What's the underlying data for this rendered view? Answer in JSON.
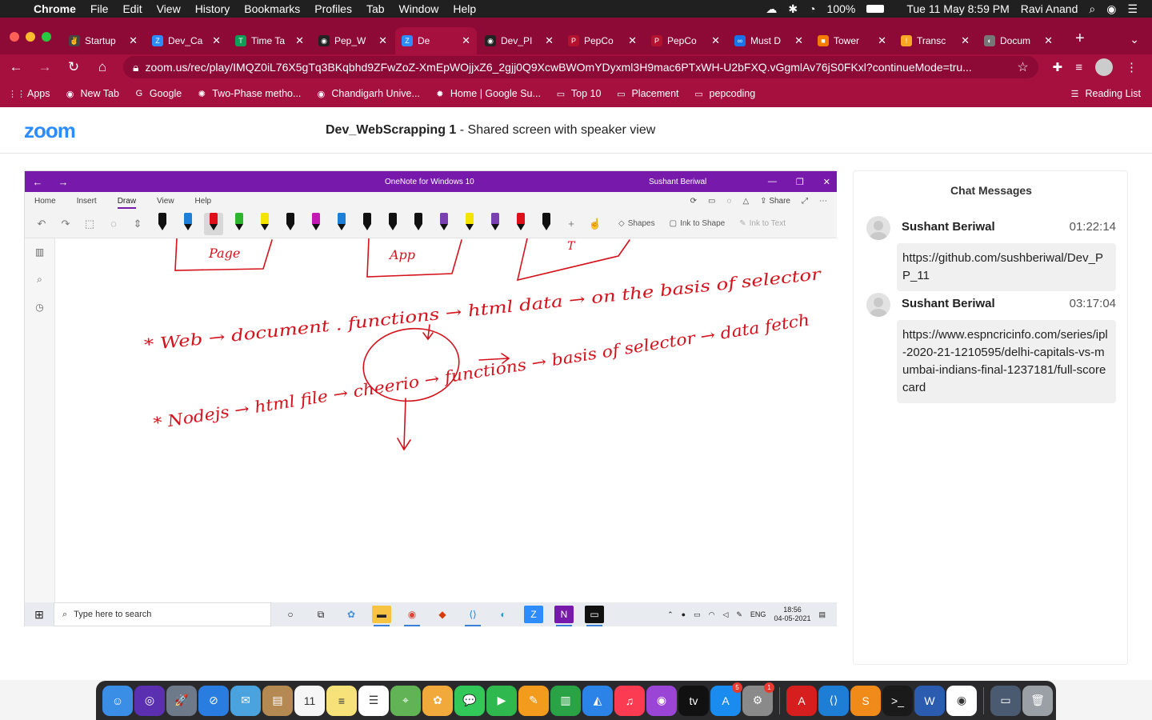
{
  "menubar": {
    "app": "Chrome",
    "items": [
      "File",
      "Edit",
      "View",
      "History",
      "Bookmarks",
      "Profiles",
      "Tab",
      "Window",
      "Help"
    ],
    "battery": "100%",
    "datetime": "Tue 11 May  8:59 PM",
    "user": "Ravi Anand"
  },
  "tabs": [
    {
      "title": "Startup",
      "color": "#444444",
      "glyph": "✌"
    },
    {
      "title": "Dev_Ca",
      "color": "#2d8cff",
      "glyph": "Z"
    },
    {
      "title": "Time Ta",
      "color": "#0f9d58",
      "glyph": "T"
    },
    {
      "title": "Pep_W",
      "color": "#222222",
      "glyph": "◉"
    },
    {
      "title": "De",
      "color": "#2d8cff",
      "glyph": "Z",
      "active": true
    },
    {
      "title": "Dev_PI",
      "color": "#222222",
      "glyph": "◉"
    },
    {
      "title": "PepCo",
      "color": "#b3122e",
      "glyph": "P"
    },
    {
      "title": "PepCo",
      "color": "#b3122e",
      "glyph": "P"
    },
    {
      "title": "Must D",
      "color": "#1a73e8",
      "glyph": "∞"
    },
    {
      "title": "Tower",
      "color": "#f57c00",
      "glyph": "■"
    },
    {
      "title": "Transc",
      "color": "#f9a825",
      "glyph": "!"
    },
    {
      "title": "Docum",
      "color": "#777777",
      "glyph": "◐"
    }
  ],
  "address": {
    "url": "zoom.us/rec/play/IMQZ0iL76X5gTq3BKqbhd9ZFwZoZ-XmEpWOjjxZ6_2gjj0Q9XcwBWOmYDyxml3H9mac6PTxWH-U2bFXQ.vGgmlAv76jS0FKxl?continueMode=tru..."
  },
  "bookmarks": [
    {
      "label": "Apps",
      "glyph": "⋮⋮"
    },
    {
      "label": "New Tab",
      "glyph": "◉"
    },
    {
      "label": "Google",
      "glyph": "G"
    },
    {
      "label": "Two-Phase metho...",
      "glyph": "✺"
    },
    {
      "label": "Chandigarh Unive...",
      "glyph": "◉"
    },
    {
      "label": "Home | Google Su...",
      "glyph": "✹"
    },
    {
      "label": "Top 10",
      "glyph": "▭"
    },
    {
      "label": "Placement",
      "glyph": "▭"
    },
    {
      "label": "pepcoding",
      "glyph": "▭"
    }
  ],
  "reading_list": "Reading List",
  "zoom": {
    "logo": "zoom",
    "title_bold": "Dev_WebScrapping 1",
    "title_rest": " - Shared screen with speaker view"
  },
  "onenote": {
    "title": "OneNote for Windows 10",
    "user": "Sushant Beriwal",
    "tabs": [
      "Home",
      "Insert",
      "Draw",
      "View",
      "Help"
    ],
    "share": "Share",
    "shapes": "Shapes",
    "ink_to_shape": "Ink to Shape",
    "ink_to_text": "Ink to Text",
    "pen_colors": [
      "#111111",
      "#1e7fd8",
      "#e0101a",
      "#2db52d",
      "#f4e400",
      "#111111",
      "#c21ab3",
      "#1e7fd8",
      "#111111",
      "#111111",
      "#111111",
      "#7a3fb0",
      "#f4e400",
      "#7a3fb0",
      "#e0101a",
      "#111111"
    ],
    "ink_text": {
      "row1": "* Web → document . functions → html data → on the basis of selector",
      "row2": "* Nodejs → html file → cheerio → functions → basis of selector → data fetch",
      "blocks": [
        "Page",
        "App",
        "T"
      ]
    }
  },
  "win_taskbar": {
    "search_placeholder": "Type here to search",
    "lang": "ENG",
    "time": "18:56",
    "date": "04-05-2021"
  },
  "chat": {
    "header": "Chat Messages",
    "messages": [
      {
        "sender": "Sushant Beriwal",
        "time": "01:22:14",
        "text": "https://github.com/sushberiwal/Dev_PP_11"
      },
      {
        "sender": "Sushant Beriwal",
        "time": "03:17:04",
        "text": "https://www.espncricinfo.com/series/ipl-2020-21-1210595/delhi-capitals-vs-mumbai-indians-final-1237181/full-scorecard"
      }
    ]
  },
  "dock": {
    "apps": [
      {
        "name": "finder",
        "color": "#3a8ee6",
        "glyph": "☺"
      },
      {
        "name": "siri",
        "color": "#5a2fb0",
        "glyph": "◎"
      },
      {
        "name": "launchpad",
        "color": "#6e7a8a",
        "glyph": "🚀"
      },
      {
        "name": "safari",
        "color": "#2a7de0",
        "glyph": "⊘"
      },
      {
        "name": "mail",
        "color": "#4aa3df",
        "glyph": "✉"
      },
      {
        "name": "contacts",
        "color": "#b58a52",
        "glyph": "▤"
      },
      {
        "name": "calendar",
        "color": "#f6f6f6",
        "glyph": "11"
      },
      {
        "name": "notes",
        "color": "#f7e27a",
        "glyph": "≡"
      },
      {
        "name": "reminders",
        "color": "#ffffff",
        "glyph": "☰"
      },
      {
        "name": "maps",
        "color": "#62b356",
        "glyph": "⌖"
      },
      {
        "name": "photos",
        "color": "#f2a93b",
        "glyph": "✿"
      },
      {
        "name": "messages",
        "color": "#32c759",
        "glyph": "💬"
      },
      {
        "name": "facetime",
        "color": "#2fb84e",
        "glyph": "▶"
      },
      {
        "name": "pages",
        "color": "#f39b1c",
        "glyph": "✎"
      },
      {
        "name": "numbers",
        "color": "#29a345",
        "glyph": "▥"
      },
      {
        "name": "keynote",
        "color": "#2b83e8",
        "glyph": "◭"
      },
      {
        "name": "music",
        "color": "#fa3b52",
        "glyph": "♫"
      },
      {
        "name": "podcasts",
        "color": "#9b45d6",
        "glyph": "◉"
      },
      {
        "name": "tv",
        "color": "#111111",
        "glyph": "tv"
      },
      {
        "name": "app-store",
        "color": "#1a8cf0",
        "glyph": "A",
        "badge": "5"
      },
      {
        "name": "system-preferences",
        "color": "#8a8a8a",
        "glyph": "⚙",
        "badge": "1"
      },
      {
        "name": "acrobat",
        "color": "#d71e1e",
        "glyph": "A"
      },
      {
        "name": "vscode",
        "color": "#1e7ed6",
        "glyph": "⟨⟩"
      },
      {
        "name": "sublime",
        "color": "#f08a18",
        "glyph": "S"
      },
      {
        "name": "terminal",
        "color": "#1a1a1a",
        "glyph": ">_"
      },
      {
        "name": "word",
        "color": "#2b5cb0",
        "glyph": "W"
      },
      {
        "name": "chrome",
        "color": "#ffffff",
        "glyph": "◉"
      },
      {
        "name": "screenshot",
        "color": "#4a5a70",
        "glyph": "▭"
      },
      {
        "name": "trash",
        "color": "#9aa0a6",
        "glyph": "🗑"
      }
    ]
  }
}
